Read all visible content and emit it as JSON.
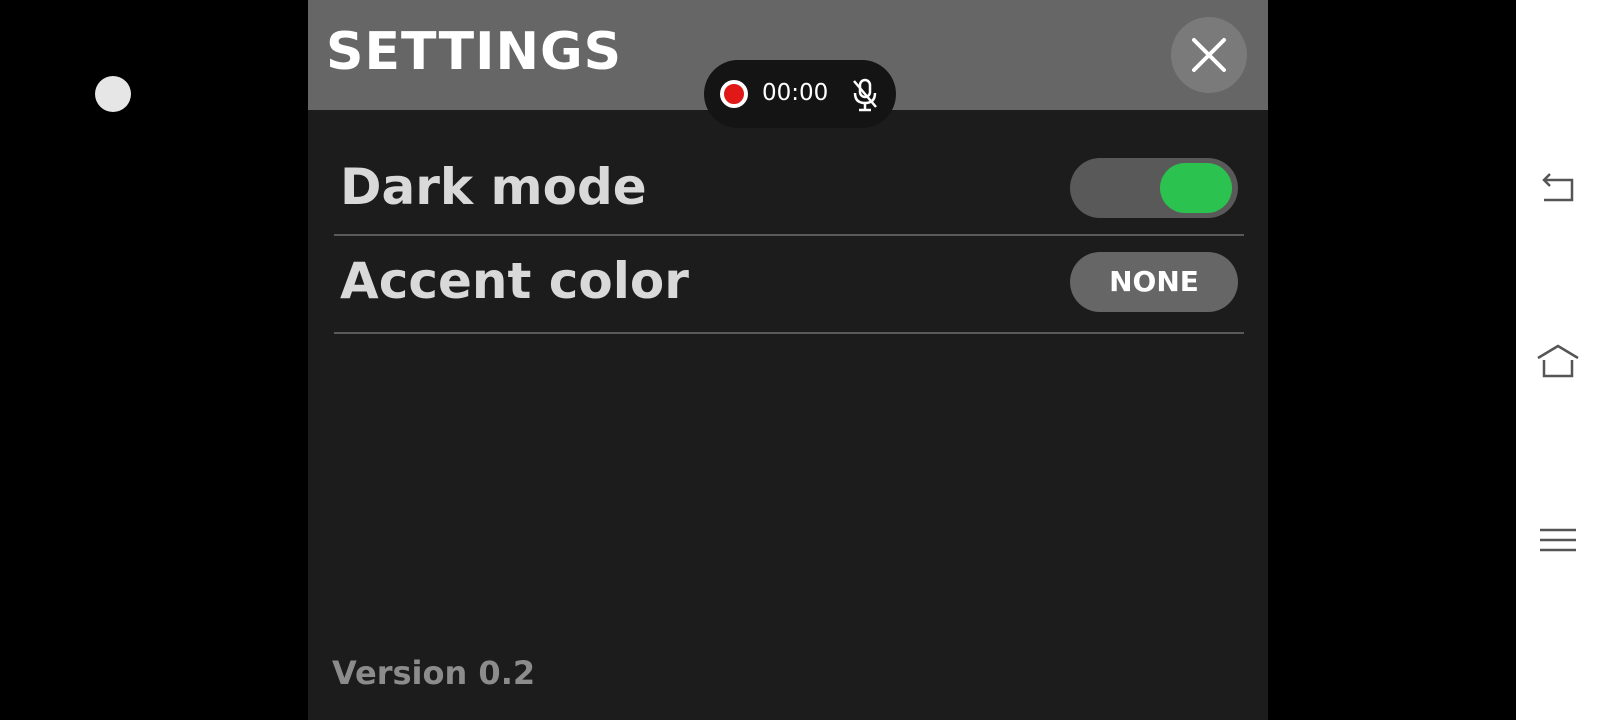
{
  "settings": {
    "title": "SETTINGS",
    "close_icon": "close-icon"
  },
  "recording": {
    "time": "00:00",
    "record_icon": "record-icon",
    "mic_icon": "mic-muted-icon"
  },
  "rows": {
    "dark_mode": {
      "label": "Dark mode",
      "enabled": true,
      "toggle_on_color": "#2cc24f"
    },
    "accent_color": {
      "label": "Accent color",
      "value": "NONE"
    }
  },
  "footer": {
    "version": "Version 0.2"
  },
  "nav": {
    "back_icon": "back-icon",
    "home_icon": "home-icon",
    "menu_icon": "menu-icon"
  }
}
